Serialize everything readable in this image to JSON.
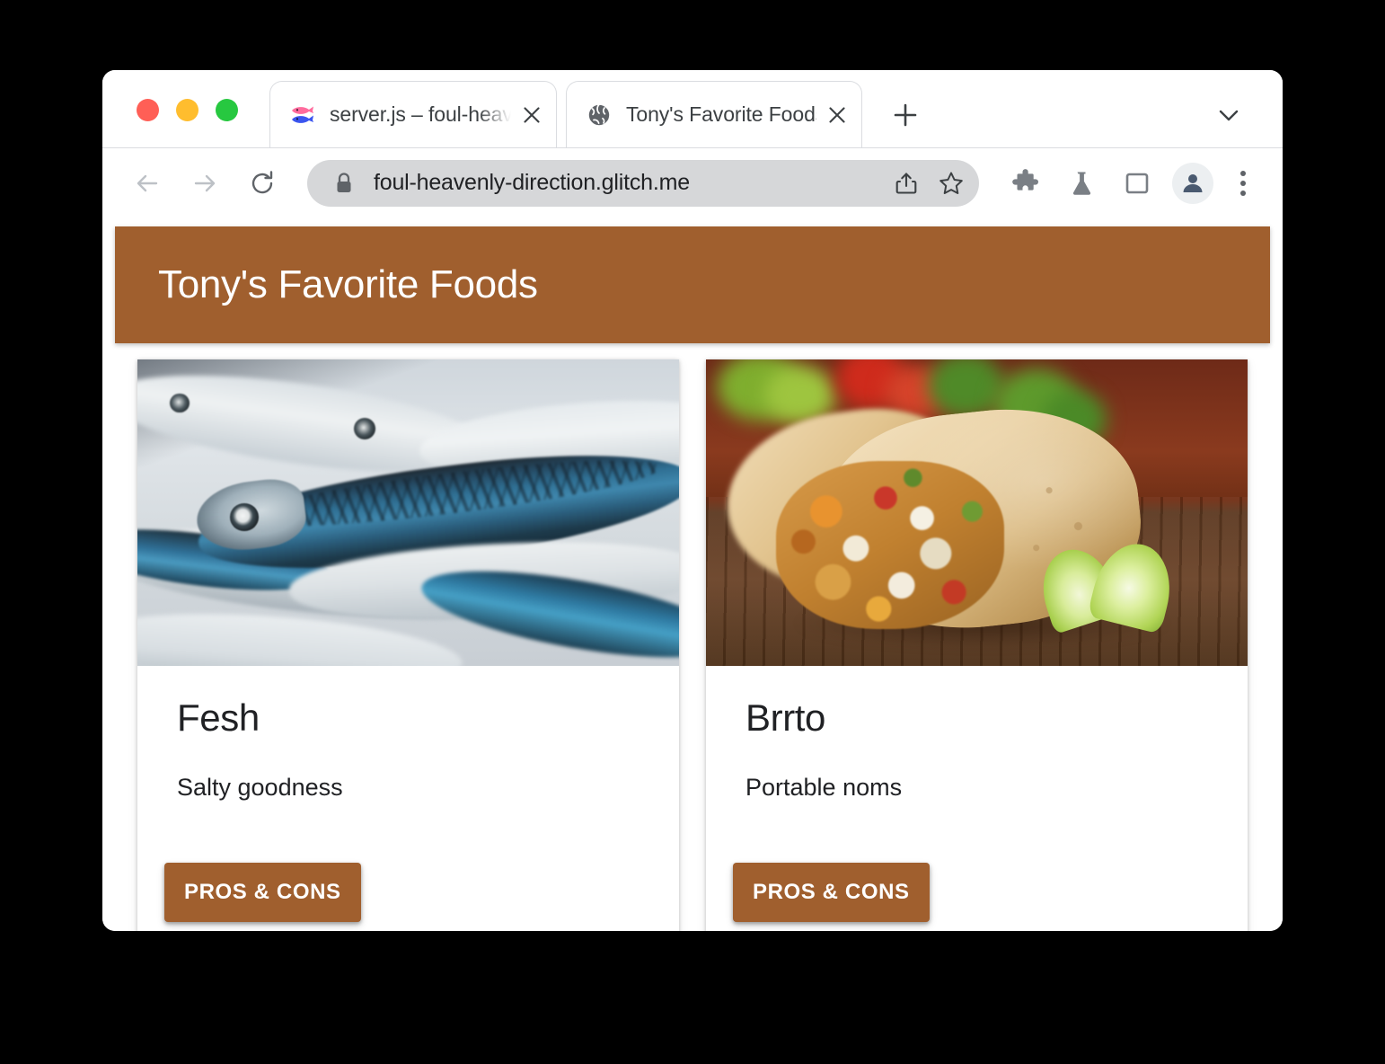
{
  "window": {
    "traffic_lights": [
      {
        "name": "close",
        "color": "#ff5f56"
      },
      {
        "name": "minimize",
        "color": "#ffbd2e"
      },
      {
        "name": "zoom",
        "color": "#27c840"
      }
    ]
  },
  "browser": {
    "tabs": [
      {
        "title": "server.js – foul-heavenly-dir",
        "favicon": "fish-favicon",
        "active": false,
        "close_label": "✕"
      },
      {
        "title": "Tony's Favorite Foods",
        "favicon": "globe-favicon",
        "active": true,
        "close_label": "✕"
      }
    ],
    "new_tab_label": "+",
    "tab_list_label": "⌄",
    "toolbar": {
      "back_label": "←",
      "forward_label": "→",
      "reload_label": "↻",
      "security_icon": "lock-icon",
      "url": "foul-heavenly-direction.glitch.me",
      "share_icon": "share-icon",
      "bookmark_icon": "star-icon",
      "extensions_icon": "puzzle-icon",
      "labs_icon": "flask-icon",
      "side_panel_icon": "side-panel-icon",
      "profile_icon": "person-icon",
      "menu_icon": "three-dot-menu-icon"
    }
  },
  "page": {
    "header": {
      "title": "Tony's Favorite Foods",
      "background": "#a05f2e",
      "text_color": "#ffffff"
    },
    "cards": [
      {
        "image": "fish-photo",
        "image_alt": "Fresh mackerel fish on ice",
        "heading": "Fesh",
        "subtitle": "Salty goodness",
        "button_label": "PROS & CONS"
      },
      {
        "image": "burrito-photo",
        "image_alt": "Chicken burrito with lime wedges on wooden table",
        "heading": "Brrto",
        "subtitle": "Portable noms",
        "button_label": "PROS & CONS"
      }
    ],
    "accent_color": "#a05f2e"
  }
}
